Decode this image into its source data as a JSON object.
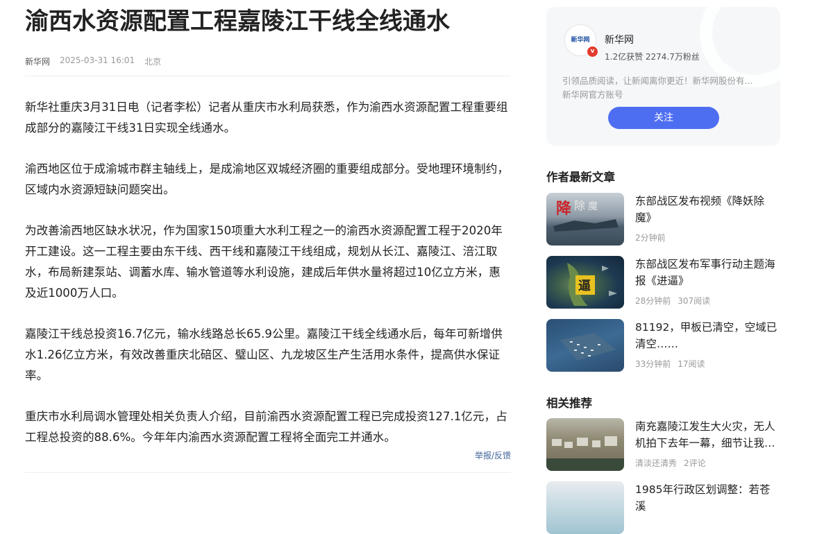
{
  "article": {
    "title": "渝西水资源配置工程嘉陵江干线全线通水",
    "source": "新华网",
    "datetime": "2025-03-31 16:01",
    "location": "北京",
    "paragraphs": [
      "新华社重庆3月31日电（记者李松）记者从重庆市水利局获悉，作为渝西水资源配置工程重要组成部分的嘉陵江干线31日实现全线通水。",
      "渝西地区位于成渝城市群主轴线上，是成渝地区双城经济圈的重要组成部分。受地理环境制约，区域内水资源短缺问题突出。",
      "为改善渝西地区缺水状况，作为国家150项重大水利工程之一的渝西水资源配置工程于2020年开工建设。这一工程主要由东干线、西干线和嘉陵江干线组成，规划从长江、嘉陵江、涪江取水，布局新建泵站、调蓄水库、输水管道等水利设施，建成后年供水量将超过10亿立方米，惠及近1000万人口。",
      "嘉陵江干线总投资16.7亿元，输水线路总长65.9公里。嘉陵江干线全线通水后，每年可新增供水1.26亿立方米，有效改善重庆北碚区、璧山区、九龙坡区生产生活用水条件，提高供水保证率。",
      "重庆市水利局调水管理处相关负责人介绍，目前渝西水资源配置工程已完成投资127.1亿元，占工程总投资的88.6%。今年年内渝西水资源配置工程将全面完工并通水。"
    ],
    "report_label": "举报/反馈"
  },
  "author": {
    "name": "新华网",
    "stats": "1.2亿获赞 2274.7万粉丝",
    "description": "引领品质阅读，让新闻离你更近！新华网股份有...",
    "tag": "新华网官方账号",
    "follow_label": "关注",
    "avatar_text": "新华网",
    "verified_mark": "v"
  },
  "latest": {
    "heading": "作者最新文章",
    "items": [
      {
        "title": "东部战区发布视频《降妖除魔》",
        "time": "2分钟前",
        "reads": ""
      },
      {
        "title": "东部战区发布军事行动主题海报《进逼》",
        "time": "28分钟前",
        "reads": "307阅读"
      },
      {
        "title": "81192，甲板已清空，空域已清空……",
        "time": "33分钟前",
        "reads": "17阅读"
      }
    ]
  },
  "related": {
    "heading": "相关推荐",
    "items": [
      {
        "title": "南充嘉陵江发生大火灾，无人机拍下去年一幕，细节让我…",
        "author": "清淡还清秀",
        "comments": "2评论"
      },
      {
        "title": "1985年行政区划调整：若苍溪",
        "author": "",
        "comments": ""
      }
    ]
  },
  "colors": {
    "accent": "#4e6ef2",
    "link": "#406599",
    "meta_gray": "#999999",
    "card_bg": "#f6f7f9"
  }
}
